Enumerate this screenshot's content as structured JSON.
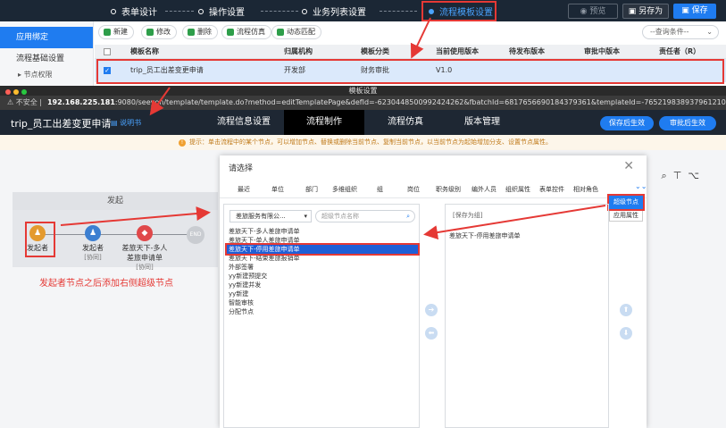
{
  "stepbar": {
    "steps": [
      "表单设计",
      "操作设置",
      "业务列表设置",
      "流程模板设置"
    ],
    "preview": "预览",
    "save_as": "另存为",
    "save": "保存"
  },
  "leftnav": {
    "items": [
      "应用绑定",
      "流程基础设置"
    ],
    "sub": "节点权限"
  },
  "toolbar": {
    "buttons": [
      "新建",
      "修改",
      "删除",
      "流程仿真",
      "动态匹配"
    ],
    "query": "--查询条件--"
  },
  "grid": {
    "headers": [
      "模板名称",
      "归属机构",
      "模板分类",
      "当前使用版本",
      "待发布版本",
      "审批中版本",
      "责任者（R）"
    ],
    "row": [
      "trip_员工出差变更申请",
      "开发部",
      "财务审批",
      "V1.0",
      "",
      "",
      ""
    ]
  },
  "window": {
    "title": "模板设置",
    "insecure": "不安全",
    "host": "192.168.225.181",
    "url_rest": ":9080/seeyon/template/template.do?method=editTemplatePage&defId=-6230448500992424262&fbatchId=6817656690184379361&templateId=-7652198389379612100&ca..."
  },
  "appbar": {
    "title": "trip_员工出差变更申请",
    "help": "说明书",
    "tabs": [
      "流程信息设置",
      "流程制作",
      "流程仿真",
      "版本管理"
    ],
    "btn_save_effect": "保存后生效",
    "btn_approve_effect": "审批后生效"
  },
  "tip": "提示：单击流程中的某个节点，可以增加节点、替换或删除当前节点、复制当前节点，以当前节点为起始增加分支、设置节点属性。",
  "flow": {
    "header": "发起",
    "nodes": [
      {
        "label": "发起者",
        "sub": ""
      },
      {
        "label": "发起者",
        "sub": "[协同]"
      },
      {
        "label": "差旅天下-多人",
        "label2": "差旅申请单",
        "sub": "[协同]"
      }
    ],
    "end": "END",
    "annotation": "发起者节点之后添加右侧超级节点"
  },
  "dialog": {
    "title": "请选择",
    "tabs": [
      "最近",
      "单位",
      "部门",
      "多维组织",
      "组",
      "岗位",
      "职务级别",
      "编外人员",
      "组织属性",
      "表单控件",
      "相对角色"
    ],
    "super_node": "超级节点",
    "app_prop": "应用属性",
    "org": "差旅服务有限公...",
    "search_placeholder": "超级节点名称",
    "list": [
      "差旅天下-多人差旅申请单",
      "差旅天下-单人差旅申请单",
      "差旅天下-停用差旅申请单",
      "差旅天下-结束差旅报销单",
      "外部签署",
      "yy新建预提交",
      "yy新建并发",
      "yy新建",
      "智能审核",
      "分配节点"
    ],
    "saved_head": "[保存为组]",
    "saved_item": "差旅天下-停用差旅申请单"
  },
  "icons": {
    "search": "search-icon",
    "close": "close-icon",
    "right": "arrow-right-icon",
    "left": "arrow-left-icon",
    "up": "arrow-up-icon",
    "down": "arrow-down-icon"
  },
  "colors": {
    "accent": "#1f7cf0",
    "annotation": "#e53935",
    "dark": "#1e2733"
  }
}
